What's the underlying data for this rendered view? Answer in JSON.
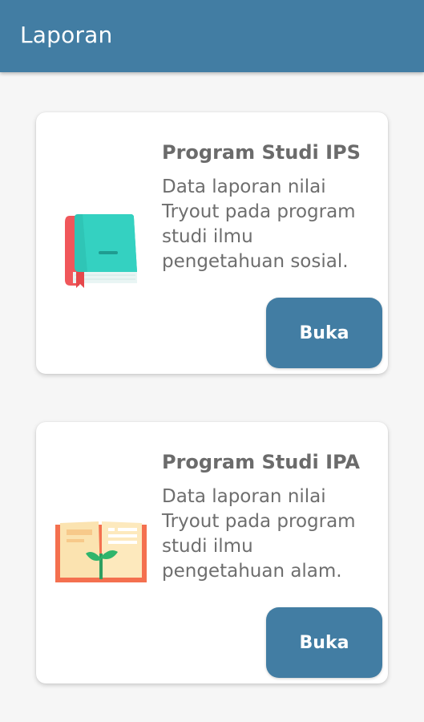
{
  "appbar": {
    "title": "Laporan"
  },
  "cards": [
    {
      "title": "Program Studi IPS",
      "description": "Data laporan nilai Tryout pada program studi ilmu pengetahuan sosial.",
      "button_label": "Buka",
      "icon": "closed-book-icon"
    },
    {
      "title": "Program Studi IPA",
      "description": "Data laporan nilai Tryout pada program studi ilmu pengetahuan alam.",
      "button_label": "Buka",
      "icon": "open-book-sprout-icon"
    }
  ],
  "colors": {
    "primary": "#427da3",
    "background": "#f6f6f6",
    "card": "#ffffff",
    "text": "#6b6b6b"
  }
}
